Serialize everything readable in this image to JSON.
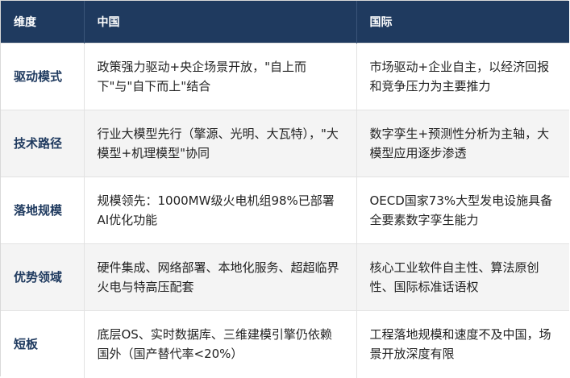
{
  "table": {
    "headers": [
      "维度",
      "中国",
      "国际"
    ],
    "rows": [
      {
        "dimension": "驱动模式",
        "china": "政策强力驱动+央企场景开放，\"自上而下\"与\"自下而上\"结合",
        "intl": "市场驱动+企业自主，以经济回报和竞争压力为主要推力"
      },
      {
        "dimension": "技术路径",
        "china": "行业大模型先行（擎源、光明、大瓦特），\"大模型+机理模型\"协同",
        "intl": "数字孪生+预测性分析为主轴，大模型应用逐步渗透"
      },
      {
        "dimension": "落地规模",
        "china": "规模领先：1000MW级火电机组98%已部署AI优化功能",
        "intl": "OECD国家73%大型发电设施具备全要素数字孪生能力"
      },
      {
        "dimension": "优势领域",
        "china": "硬件集成、网络部署、本地化服务、超超临界火电与特高压配套",
        "intl": "核心工业软件自主性、算法原创性、国际标准话语权"
      },
      {
        "dimension": "短板",
        "china": "底层OS、实时数据库、三维建模引擎仍依赖国外（国产替代率<20%）",
        "intl": "工程落地规模和速度不及中国，场景开放深度有限"
      }
    ]
  }
}
